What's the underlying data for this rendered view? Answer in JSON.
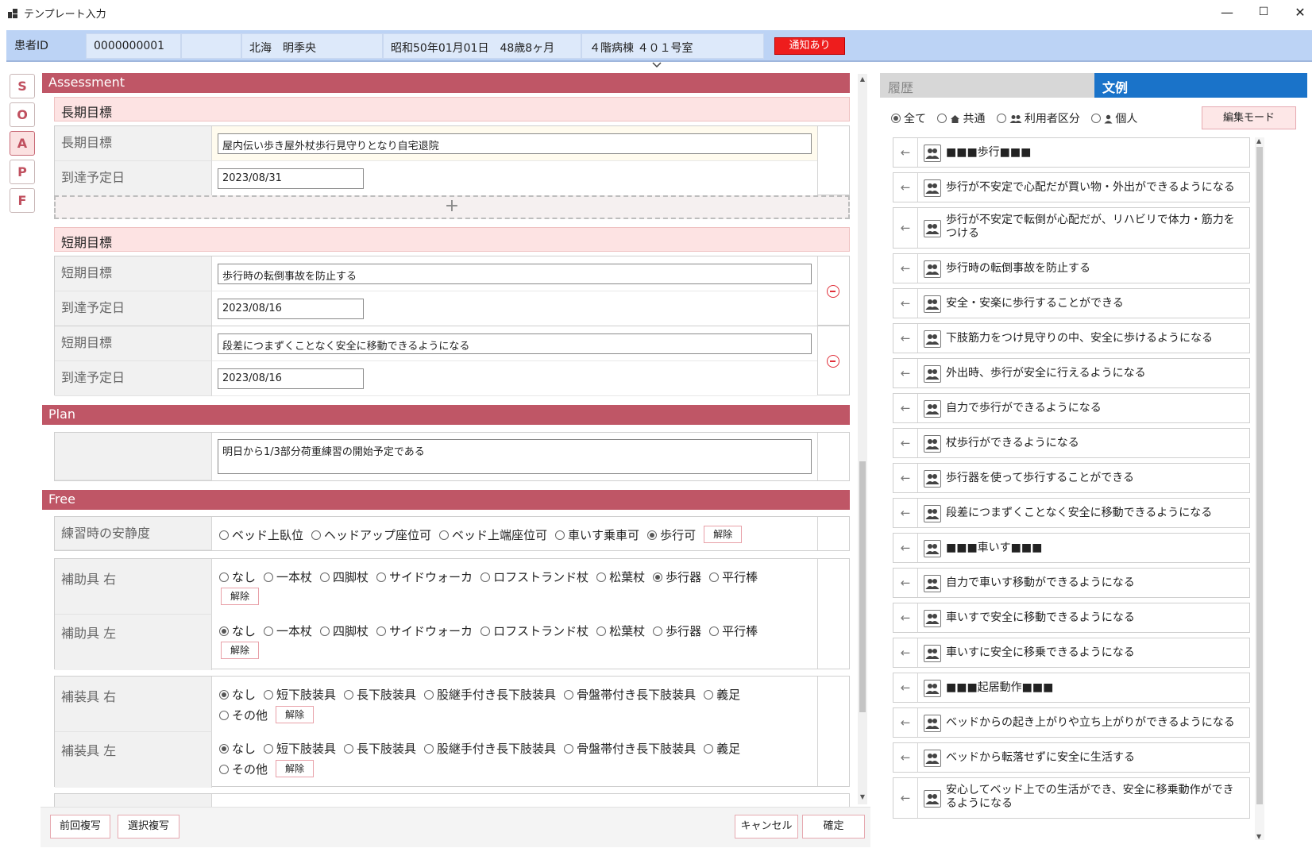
{
  "window": {
    "title": "テンプレート入力",
    "minimize": "—",
    "maximize": "☐",
    "close": "✕"
  },
  "patient": {
    "id_label": "患者ID",
    "id": "0000000001",
    "name": "北海　明季央",
    "birth": "昭和50年01月01日　48歳8ヶ月",
    "ward": "４階病棟 ４０１号室",
    "notify": "通知あり"
  },
  "soap_tabs": [
    "S",
    "O",
    "A",
    "P",
    "F"
  ],
  "assessment": {
    "title": "Assessment",
    "long_goal": {
      "header": "長期目標",
      "label": "長期目標",
      "value": "屋内伝い歩き屋外杖歩行見守りとなり自宅退院",
      "date_label": "到達予定日",
      "date": "2023/08/31",
      "add": "+"
    },
    "short_goal": {
      "header": "短期目標",
      "items": [
        {
          "label": "短期目標",
          "value": "歩行時の転倒事故を防止する",
          "date_label": "到達予定日",
          "date": "2023/08/16"
        },
        {
          "label": "短期目標",
          "value": "段差につまずくことなく安全に移動できるようになる",
          "date_label": "到達予定日",
          "date": "2023/08/16"
        }
      ]
    }
  },
  "plan": {
    "title": "Plan",
    "value": "明日から1/3部分荷重練習の開始予定である"
  },
  "free": {
    "title": "Free",
    "rest": {
      "label": "練習時の安静度",
      "options": [
        "ベッド上臥位",
        "ヘッドアップ座位可",
        "ベッド上端座位可",
        "車いす乗車可",
        "歩行可"
      ],
      "selected": 4,
      "clear": "解除"
    },
    "aids": [
      {
        "label": "補助具 右",
        "options": [
          "なし",
          "一本杖",
          "四脚杖",
          "サイドウォーカ",
          "ロフストランド杖",
          "松葉杖",
          "歩行器",
          "平行棒"
        ],
        "selected": 6,
        "clear": "解除"
      },
      {
        "label": "補助具 左",
        "options": [
          "なし",
          "一本杖",
          "四脚杖",
          "サイドウォーカ",
          "ロフストランド杖",
          "松葉杖",
          "歩行器",
          "平行棒"
        ],
        "selected": 0,
        "clear": "解除"
      }
    ],
    "braces": [
      {
        "label": "補装具 右",
        "options": [
          "なし",
          "短下肢装具",
          "長下肢装具",
          "股継手付き長下肢装具",
          "骨盤帯付き長下肢装具",
          "義足"
        ],
        "extra": "その他",
        "selected": 0,
        "clear": "解除"
      },
      {
        "label": "補装具 左",
        "options": [
          "なし",
          "短下肢装具",
          "長下肢装具",
          "股継手付き長下肢装具",
          "骨盤帯付き長下肢装具",
          "義足"
        ],
        "extra": "その他",
        "selected": 0,
        "clear": "解除"
      }
    ]
  },
  "bottom": {
    "prev_copy": "前回複写",
    "sel_copy": "選択複写",
    "cancel": "キャンセル",
    "confirm": "確定"
  },
  "right": {
    "tab_history": "履歴",
    "tab_examples": "文例",
    "filters": [
      "全て",
      "共通",
      "利用者区分",
      "個人"
    ],
    "edit_mode": "編集モード",
    "items": [
      "■■■歩行■■■",
      "歩行が不安定で心配だが買い物・外出ができるようになる",
      "歩行が不安定で転倒が心配だが、リハビリで体力・筋力をつける",
      "歩行時の転倒事故を防止する",
      "安全・安楽に歩行することができる",
      "下肢筋力をつけ見守りの中、安全に歩けるようになる",
      "外出時、歩行が安全に行えるようになる",
      "自力で歩行ができるようになる",
      "杖歩行ができるようになる",
      "歩行器を使って歩行することができる",
      "段差につまずくことなく安全に移動できるようになる",
      "■■■車いす■■■",
      "自力で車いす移動ができるようになる",
      "車いすで安全に移動できるようになる",
      "車いすに安全に移乗できるようになる",
      "■■■起居動作■■■",
      "ベッドからの起き上がりや立ち上がりができるようになる",
      "ベッドから転落せずに安全に生活する",
      "安心してベッド上での生活ができ、安全に移乗動作ができるようになる"
    ]
  }
}
